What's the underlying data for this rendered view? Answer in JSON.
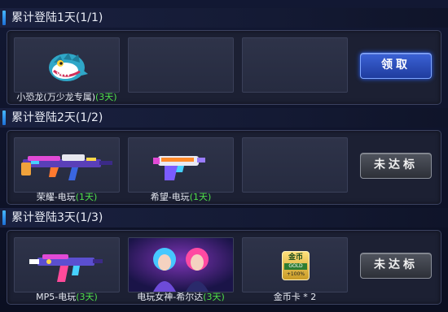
{
  "sections": [
    {
      "title": "累计登陆1天(1/1)",
      "button": "领取",
      "button_state": "claimable",
      "rewards": [
        {
          "name": "小恐龙(万少龙专属)",
          "days": "(3天)",
          "icon": "dinosaur-icon"
        }
      ]
    },
    {
      "title": "累计登陆2天(1/2)",
      "button": "未达标",
      "button_state": "locked",
      "rewards": [
        {
          "name": "荣耀-电玩",
          "days": "(1天)",
          "icon": "rifle-icon"
        },
        {
          "name": "希望-电玩",
          "days": "(1天)",
          "icon": "pistol-icon"
        }
      ]
    },
    {
      "title": "累计登陆3天(1/3)",
      "button": "未达标",
      "button_state": "locked",
      "rewards": [
        {
          "name": "MP5-电玩",
          "days": "(3天)",
          "icon": "smg-icon"
        },
        {
          "name": "电玩女神-希尔达",
          "days": "(3天)",
          "icon": "character-portrait-icon"
        },
        {
          "name": "金币卡 * 2",
          "days": "",
          "icon": "gold-coin-card-icon",
          "card_text": {
            "top": "金币",
            "mid": "GOLD",
            "bot": "+100%"
          }
        }
      ]
    }
  ],
  "colors": {
    "accent": "#46b9ff",
    "days_green": "#4fe04a",
    "claim_blue": "#3b62d6",
    "locked_gray": "#50545e"
  }
}
